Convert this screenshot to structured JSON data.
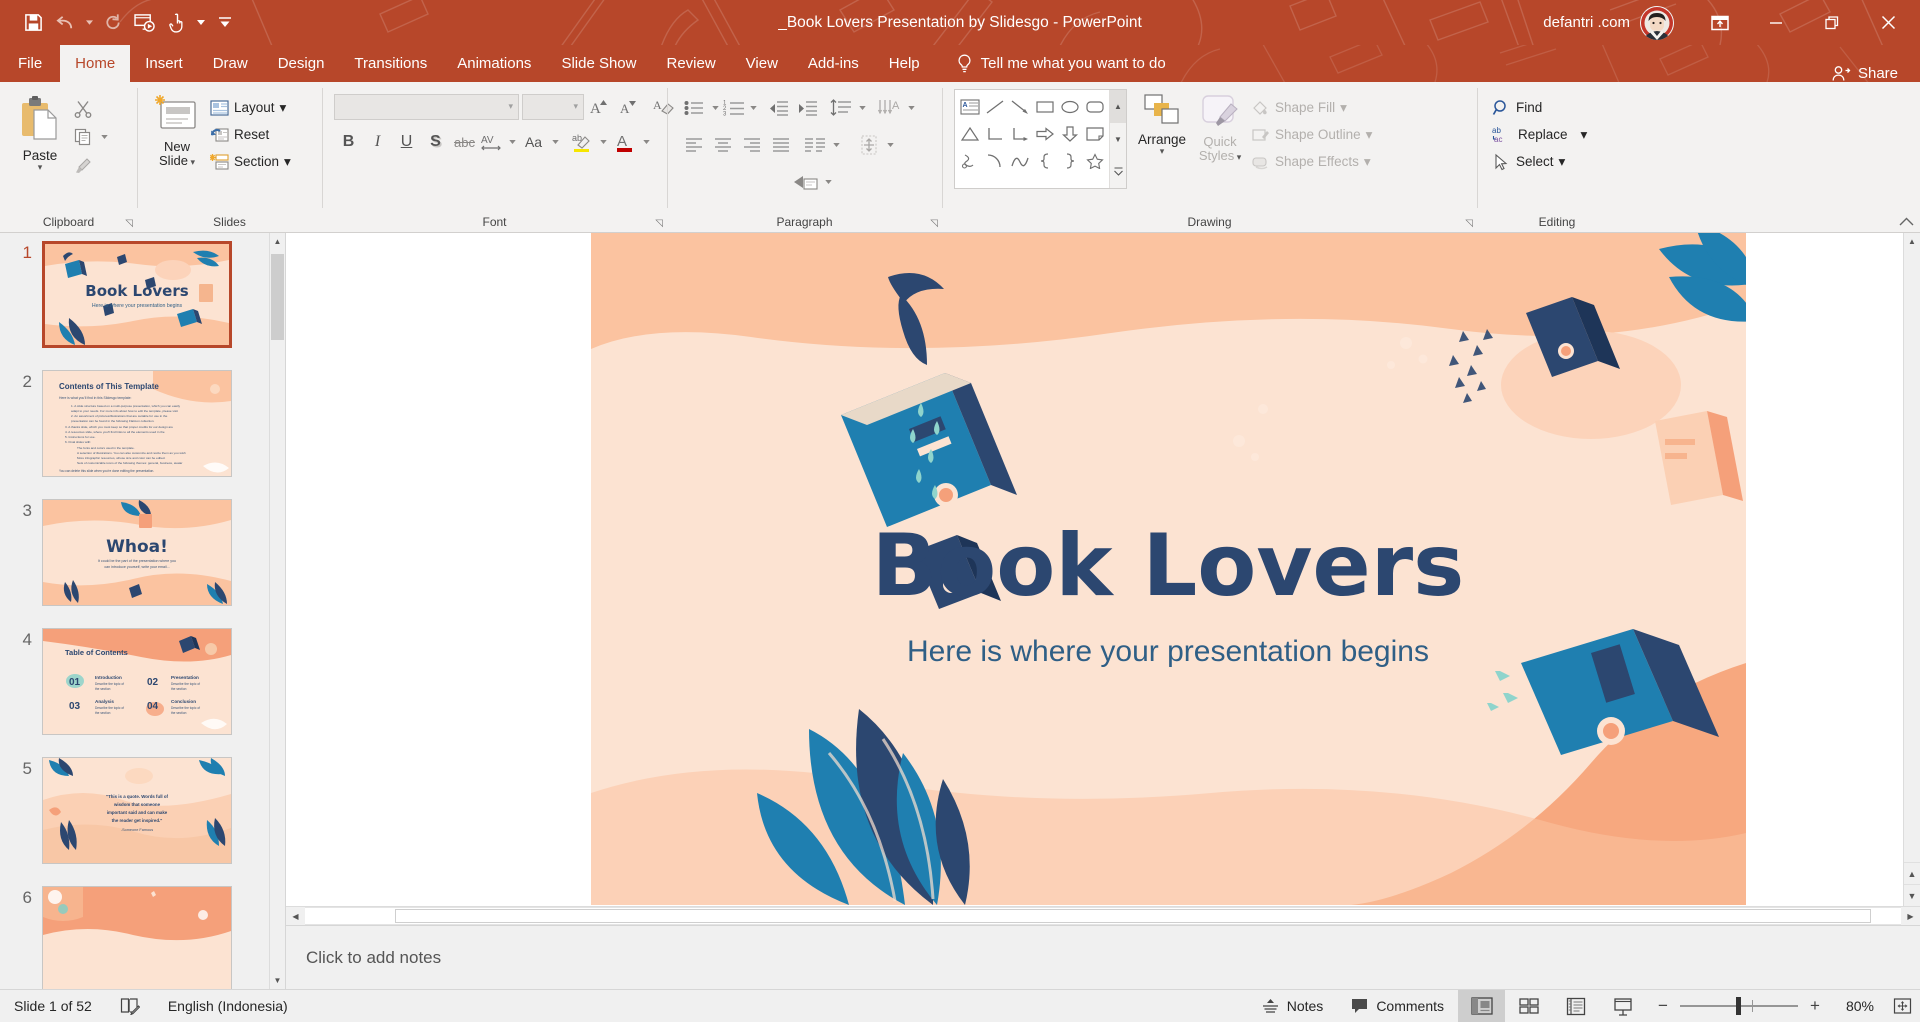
{
  "titlebar": {
    "document_title": "_Book Lovers Presentation by Slidesgo  -  PowerPoint",
    "account_name": "defantri .com",
    "qat": [
      {
        "name": "save",
        "label": "Save"
      },
      {
        "name": "undo",
        "label": "Undo"
      },
      {
        "name": "redo",
        "label": "Redo"
      },
      {
        "name": "start-from-beginning",
        "label": "Start From Beginning"
      },
      {
        "name": "touch-mouse-mode",
        "label": "Touch/Mouse Mode"
      },
      {
        "name": "customize-qat",
        "label": "Customize Quick Access Toolbar"
      }
    ],
    "window_controls": [
      {
        "name": "ribbon-display-options",
        "label": "Ribbon Display Options"
      },
      {
        "name": "minimize",
        "label": "Minimize"
      },
      {
        "name": "restore",
        "label": "Restore Down"
      },
      {
        "name": "close",
        "label": "Close"
      }
    ]
  },
  "tabs": [
    {
      "label": "File",
      "active": false
    },
    {
      "label": "Home",
      "active": true
    },
    {
      "label": "Insert",
      "active": false
    },
    {
      "label": "Draw",
      "active": false
    },
    {
      "label": "Design",
      "active": false
    },
    {
      "label": "Transitions",
      "active": false
    },
    {
      "label": "Animations",
      "active": false
    },
    {
      "label": "Slide Show",
      "active": false
    },
    {
      "label": "Review",
      "active": false
    },
    {
      "label": "View",
      "active": false
    },
    {
      "label": "Add-ins",
      "active": false
    },
    {
      "label": "Help",
      "active": false
    }
  ],
  "tellme": {
    "label": "Tell me what you want to do"
  },
  "share": {
    "label": "Share"
  },
  "ribbon": {
    "groups": [
      {
        "name": "clipboard",
        "label": "Clipboard"
      },
      {
        "name": "slides",
        "label": "Slides"
      },
      {
        "name": "font",
        "label": "Font"
      },
      {
        "name": "paragraph",
        "label": "Paragraph"
      },
      {
        "name": "drawing",
        "label": "Drawing"
      },
      {
        "name": "editing",
        "label": "Editing"
      }
    ],
    "clipboard": {
      "paste": "Paste",
      "cut_tip": "Cut",
      "copy_tip": "Copy",
      "format_painter_tip": "Format Painter"
    },
    "slides": {
      "new_slide": "New\nSlide",
      "new_slide_line1": "New",
      "new_slide_line2": "Slide",
      "layout": "Layout",
      "reset": "Reset",
      "section": "Section"
    },
    "font": {
      "font_name_value": "",
      "font_size_value": "",
      "bold": "B",
      "italic": "I",
      "underline": "U",
      "shadow": "S",
      "strikethrough": "abc",
      "char_spacing": "AV",
      "change_case": "Aa",
      "grow_font": "A",
      "shrink_font": "A",
      "clear_formatting_tip": "Clear All Formatting",
      "highlight_tip": "Text Highlight Color",
      "font_color_tip": "Font Color"
    },
    "paragraph": {
      "bullets_tip": "Bullets",
      "numbering_tip": "Numbering",
      "decrease_indent_tip": "Decrease List Level",
      "increase_indent_tip": "Increase List Level",
      "line_spacing_tip": "Line Spacing",
      "align_left_tip": "Align Left",
      "center_tip": "Center",
      "align_right_tip": "Align Right",
      "justify_tip": "Justify",
      "columns_tip": "Add or Remove Columns",
      "text_direction_tip": "Text Direction",
      "align_text_tip": "Align Text",
      "convert_smartart_tip": "Convert to SmartArt"
    },
    "drawing": {
      "arrange": "Arrange",
      "quick_styles_line1": "Quick",
      "quick_styles_line2": "Styles",
      "shape_fill": "Shape Fill",
      "shape_outline": "Shape Outline",
      "shape_effects": "Shape Effects",
      "shapes": [
        "text-box",
        "line",
        "line-arrow",
        "rectangle",
        "oval",
        "rounded-rectangle",
        "isosceles-triangle",
        "elbow-connector",
        "elbow-arrow-connector",
        "right-arrow",
        "down-arrow",
        "folded-corner",
        "scribble",
        "arc",
        "curve",
        "left-brace",
        "right-brace",
        "five-point-star"
      ]
    },
    "editing": {
      "find": "Find",
      "replace": "Replace",
      "select": "Select"
    },
    "collapse_tip": "Collapse the Ribbon"
  },
  "thumbnails": [
    {
      "number": "1",
      "active": true,
      "kind": "title",
      "title": "Book Lovers",
      "subtitle": "Here is where your presentation begins"
    },
    {
      "number": "2",
      "active": false,
      "kind": "contents",
      "title": "Contents of This Template",
      "intro": "Here is what you'll find in this Slidesgo template:"
    },
    {
      "number": "3",
      "active": false,
      "kind": "whoa",
      "title": "Whoa!",
      "subtitle": "Is could be the part of the presentation where you can introduce yourself, write your email..."
    },
    {
      "number": "4",
      "active": false,
      "kind": "toc",
      "title": "Table of Contents",
      "items": [
        {
          "num": "01",
          "label": "Introduction",
          "desc": "Describe the topic of the section"
        },
        {
          "num": "02",
          "label": "Presentation",
          "desc": "Describe the topic of the section"
        },
        {
          "num": "03",
          "label": "Analysis",
          "desc": "Describe the topic of the section"
        },
        {
          "num": "04",
          "label": "Conclusion",
          "desc": "Describe the topic of the section"
        }
      ]
    },
    {
      "number": "5",
      "active": false,
      "kind": "quote",
      "quote": "\"This is a quote. Words full of wisdom that someone important said and can make the reader get inspired.\"",
      "author": "-Someone Famous"
    },
    {
      "number": "6",
      "active": false,
      "kind": "plain",
      "title": "",
      "subtitle": ""
    }
  ],
  "slide": {
    "title": "Book Lovers",
    "subtitle": "Here is where your presentation begins",
    "colors": {
      "background": "#fce3d2",
      "peach_wave": "#fbc3a0",
      "deep_blue": "#2c4770",
      "teal_blue": "#1f7fb0",
      "title_color": "#2c4770",
      "subtitle_color": "#2f5f86",
      "accent_orange": "#f5a07a"
    }
  },
  "notes": {
    "placeholder": "Click to add notes"
  },
  "status": {
    "slide_counter": "Slide 1 of 52",
    "language": "English (Indonesia)",
    "accessibility_tip": "Accessibility Checker",
    "notes_label": "Notes",
    "comments_label": "Comments",
    "views": [
      {
        "name": "normal-view",
        "label": "Normal",
        "active": true
      },
      {
        "name": "slide-sorter-view",
        "label": "Slide Sorter",
        "active": false
      },
      {
        "name": "reading-view",
        "label": "Reading View",
        "active": false
      },
      {
        "name": "slide-show-view",
        "label": "Slide Show",
        "active": false
      }
    ],
    "zoom_out": "−",
    "zoom_in": "+",
    "zoom_level": "80%",
    "fit_tip": "Fit slide to current window"
  },
  "theme": {
    "ribbon_red": "#b7472a",
    "ribbon_bg": "#f3f2f1",
    "selection_red": "#b7472a"
  }
}
